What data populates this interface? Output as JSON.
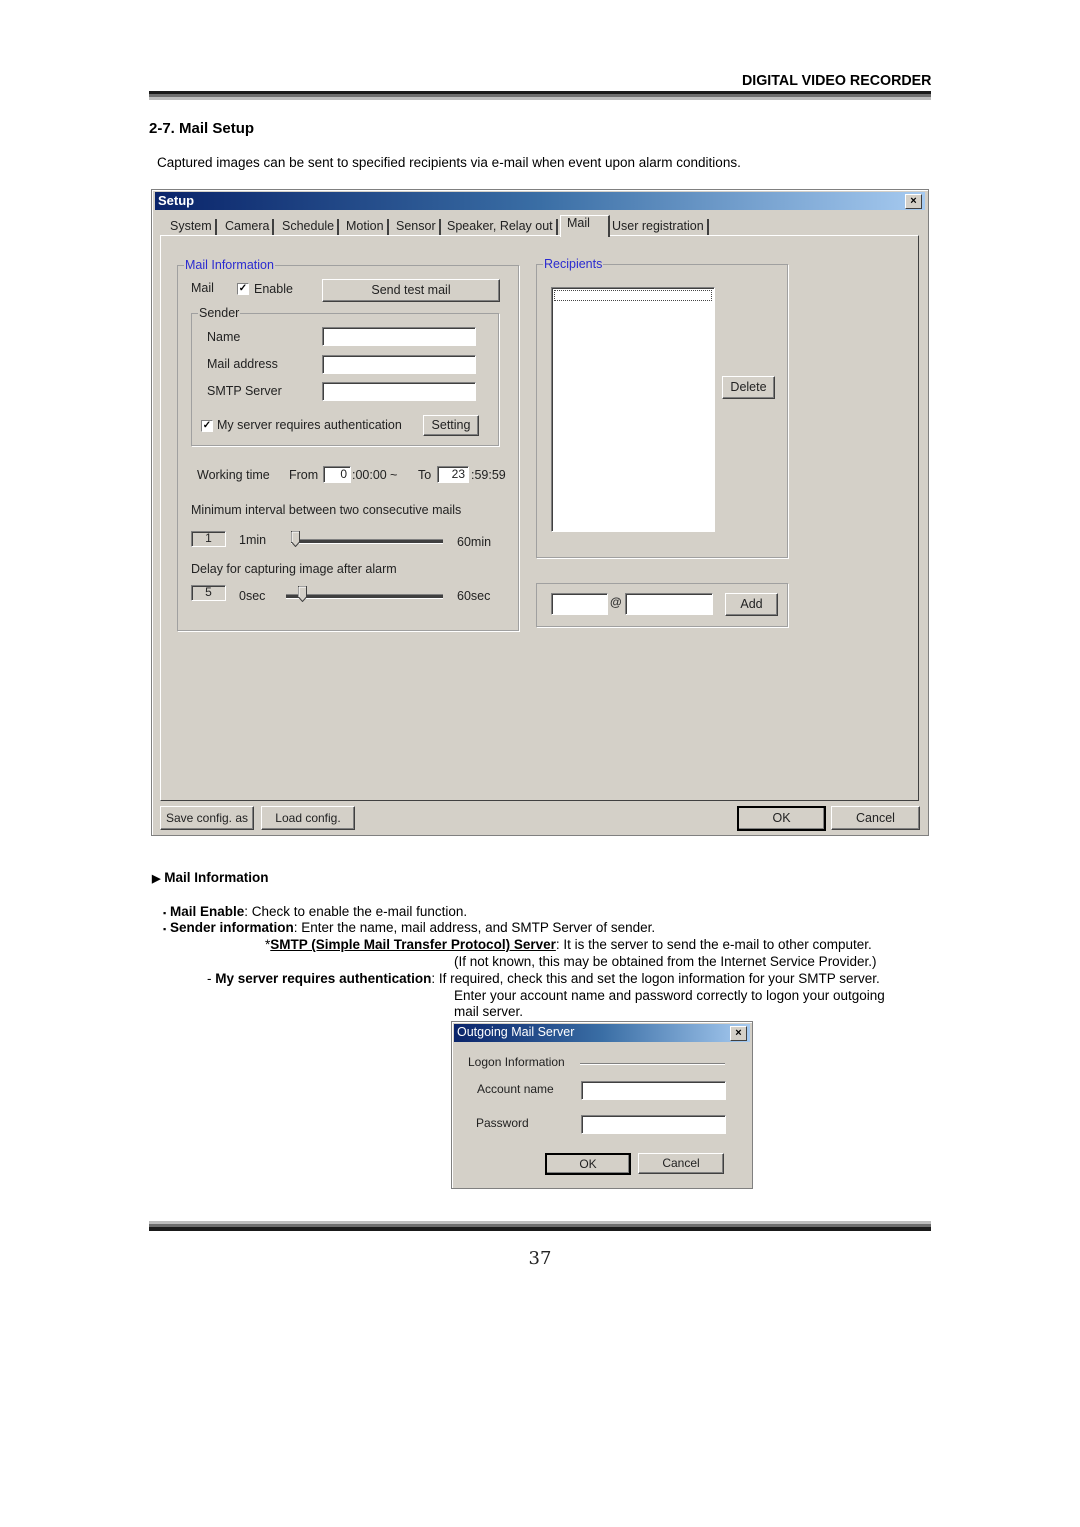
{
  "header": {
    "title": "DIGITAL VIDEO RECORDER",
    "section_title": "2-7. Mail Setup",
    "intro": "Captured images can be sent to specified recipients via e-mail when event upon alarm conditions."
  },
  "setup_window": {
    "title": "Setup",
    "close_glyph": "×",
    "tabs": [
      {
        "label": "System",
        "active": false
      },
      {
        "label": "Camera",
        "active": false
      },
      {
        "label": "Schedule",
        "active": false
      },
      {
        "label": "Motion",
        "active": false
      },
      {
        "label": "Sensor",
        "active": false
      },
      {
        "label": "Speaker, Relay out",
        "active": false
      },
      {
        "label": "Mail",
        "active": true
      },
      {
        "label": "User registration",
        "active": false
      }
    ],
    "mail_information": {
      "group_label": "Mail Information",
      "mail_label": "Mail",
      "enable_label": "Enable",
      "enable_checked": true,
      "check_glyph": "✓",
      "send_test_mail_label": "Send test mail",
      "sender": {
        "group_label": "Sender",
        "name_label": "Name",
        "name_value": "",
        "mail_address_label": "Mail address",
        "mail_address_value": "",
        "smtp_server_label": "SMTP Server",
        "smtp_server_value": "",
        "auth_label": "My server requires authentication",
        "auth_checked": true,
        "setting_label": "Setting"
      },
      "working_time": {
        "label": "Working time",
        "from_label": "From",
        "from_hour": "0",
        "from_suffix": ":00:00",
        "tilde": "~",
        "to_label": "To",
        "to_hour": "23",
        "to_suffix": ":59:59"
      },
      "min_interval": {
        "label": "Minimum interval between two consecutive mails",
        "value": "1",
        "min_label": "1min",
        "max_label": "60min",
        "min": 1,
        "max": 60,
        "current": 1
      },
      "capture_delay": {
        "label": "Delay for capturing image after alarm",
        "value": "5",
        "min_label": "0sec",
        "max_label": "60sec",
        "min": 0,
        "max": 60,
        "current": 5
      }
    },
    "recipients": {
      "group_label": "Recipients",
      "items": [],
      "delete_label": "Delete",
      "user_value": "",
      "at_sign": "@",
      "domain_value": "",
      "add_label": "Add"
    },
    "footer": {
      "save_config_label": "Save config. as",
      "load_config_label": "Load config.",
      "ok_label": "OK",
      "cancel_label": "Cancel"
    }
  },
  "description": {
    "heading_marker": "▶",
    "heading": "Mail Information",
    "items": {
      "mail_enable_bullet": "▪",
      "mail_enable_term": "Mail Enable",
      "mail_enable_text": ": Check to enable the e-mail function.",
      "sender_bullet": "▪",
      "sender_term": "Sender information",
      "sender_text": ": Enter the name, mail address, and SMTP Server of sender.",
      "smtp_star": "*",
      "smtp_term": "SMTP (Simple Mail Transfer Protocol) Server",
      "smtp_text": ": It is the server to send the e-mail to other computer.",
      "smtp_note": "(If not known, this may be obtained from the Internet Service Provider.)",
      "auth_dash": "- ",
      "auth_term": "My server requires authentication",
      "auth_text": ": If required, check this and set the logon information for your SMTP server.",
      "auth_line2": "Enter your account name and password correctly to logon your outgoing",
      "auth_line3": "mail server."
    }
  },
  "outgoing_dialog": {
    "title": "Outgoing Mail Server",
    "close_glyph": "×",
    "logon_label": "Logon Information",
    "account_label": "Account name",
    "account_value": "",
    "password_label": "Password",
    "password_value": "",
    "ok_label": "OK",
    "cancel_label": "Cancel"
  },
  "page_number": "37"
}
